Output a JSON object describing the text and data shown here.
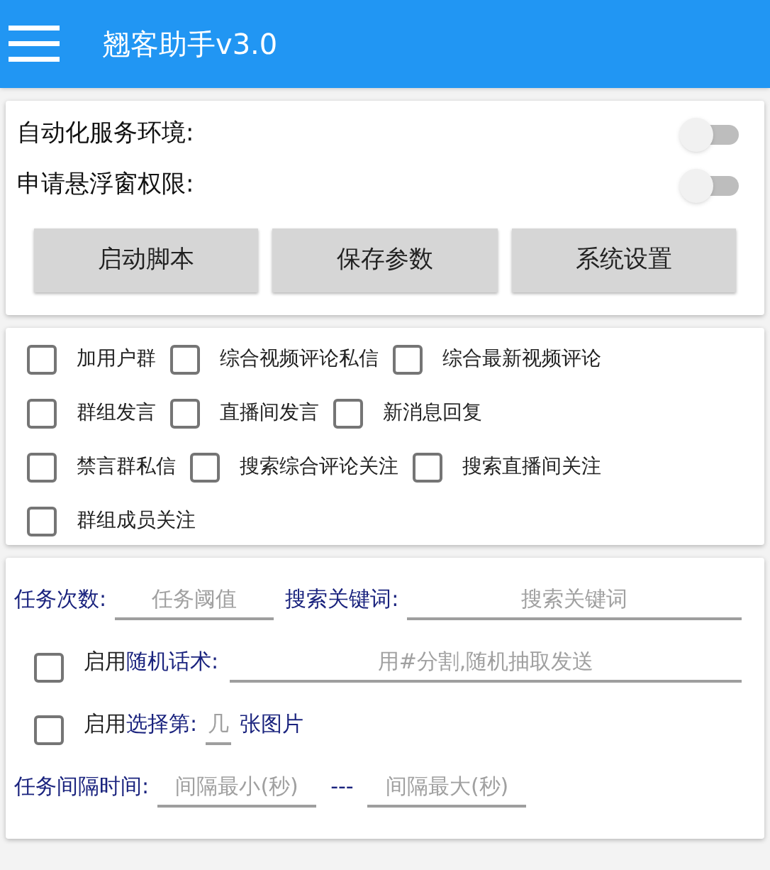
{
  "header": {
    "title": "翘客助手v3.0"
  },
  "switches": [
    {
      "label": "自动化服务环境:",
      "on": false
    },
    {
      "label": "申请悬浮窗权限:",
      "on": false
    }
  ],
  "buttons": [
    "启动脚本",
    "保存参数",
    "系统设置"
  ],
  "option_rows": [
    [
      {
        "label": "加用户群",
        "checked": false
      },
      {
        "label": "综合视频评论私信",
        "checked": false
      },
      {
        "label": "综合最新视频评论",
        "checked": false
      }
    ],
    [
      {
        "label": "群组发言",
        "checked": false
      },
      {
        "label": "直播间发言",
        "checked": false
      },
      {
        "label": "新消息回复",
        "checked": false
      }
    ],
    [
      {
        "label": "禁言群私信",
        "checked": false
      },
      {
        "label": "搜索综合评论关注",
        "checked": false
      },
      {
        "label": "搜索直播间关注",
        "checked": false
      }
    ],
    [
      {
        "label": "群组成员关注",
        "checked": false
      }
    ]
  ],
  "settings": {
    "task_count": {
      "label": "任务次数:",
      "placeholder": "任务阈值"
    },
    "search_keyword": {
      "label": "搜索关键词:",
      "placeholder": "搜索关键词"
    },
    "random_script": {
      "prefix": "启用",
      "label": "随机话术:",
      "checked": false,
      "placeholder": "用#分割,随机抽取发送"
    },
    "pick_image": {
      "prefix": "启用",
      "label": "选择第:",
      "checked": false,
      "placeholder": "几",
      "suffix": "张图片"
    },
    "interval": {
      "label": "任务间隔时间:",
      "min_placeholder": "间隔最小(秒)",
      "separator": "---",
      "max_placeholder": "间隔最大(秒)"
    }
  }
}
